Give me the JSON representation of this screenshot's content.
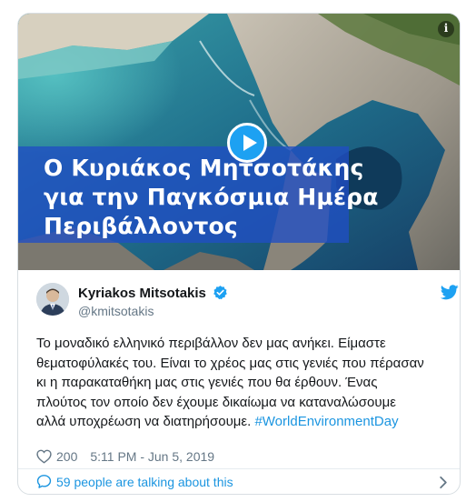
{
  "media": {
    "caption_lines": [
      "Ο Κυριάκος Μητσοτάκης",
      "για την Παγκόσμια Ημέρα",
      "Περιβάλλοντος"
    ],
    "play_icon": "play-icon",
    "info_icon": "info-icon",
    "info_glyph": "i"
  },
  "author": {
    "display_name": "Kyriakos Mitsotakis",
    "handle": "@kmitsotakis",
    "verified": true
  },
  "tweet": {
    "text_plain": "Το μοναδικό ελληνικό περιβάλλον δεν μας ανήκει. Είμαστε\nθεματοφύλακές του. Είναι το χρέος μας στις γενιές που πέρασαν\nκι η παρακαταθήκη μας στις γενιές που θα έρθουν. Ένας\nπλούτος τον οποίο δεν έχουμε δικαίωμα να καταναλώσουμε\nαλλά υποχρέωση να διατηρήσουμε. ",
    "hashtag": "#WorldEnvironmentDay"
  },
  "meta": {
    "like_count": "200",
    "timestamp": "5:11 PM - Jun 5, 2019"
  },
  "conversation": {
    "label": "59 people are talking about this"
  },
  "colors": {
    "brand_blue": "#1da1f2",
    "link_blue": "#1b95e0",
    "muted_gray": "#657786",
    "caption_band": "#204ec4"
  }
}
